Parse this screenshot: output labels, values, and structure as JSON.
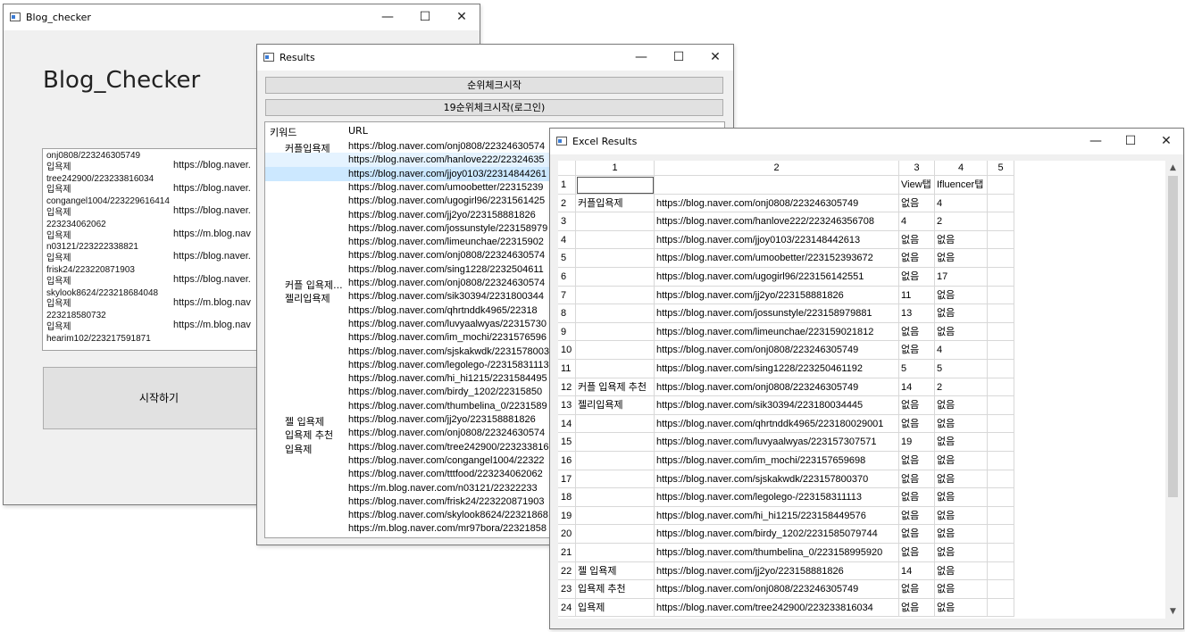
{
  "window_main": {
    "title": "Blog_checker",
    "heading": "Blog_Checker",
    "start_label": "시작하기",
    "log_lines": [
      "onj0808/223246305749",
      "입욕제",
      "tree242900/223233816034",
      "입욕제",
      "congangel1004/223229616414",
      "입욕제",
      "223234062062",
      "입욕제",
      "n03121/223222338821",
      "입욕제",
      "frisk24/223220871903",
      "입욕제",
      "skylook8624/223218684048",
      "입욕제",
      "223218580732",
      "입욕제",
      "hearim102/223217591871"
    ],
    "log_urls": [
      "https://blog.naver.",
      "https://blog.naver.",
      "https://blog.naver.",
      "https://m.blog.nav",
      "https://blog.naver.",
      "https://blog.naver.",
      "https://m.blog.nav",
      "https://m.blog.nav"
    ]
  },
  "window_results": {
    "title": "Results",
    "rank_check_label": "순위체크시작",
    "rank_check_19_label": "19순위체크시작(로그인)",
    "columns": [
      "키워드",
      "URL"
    ],
    "rows": [
      {
        "kw": "커플입욕제",
        "url": "https://blog.naver.com/onj0808/22324630574"
      },
      {
        "kw": "",
        "url": "https://blog.naver.com/hanlove222/22324635"
      },
      {
        "kw": "",
        "url": "https://blog.naver.com/jjoy0103/22314844261"
      },
      {
        "kw": "",
        "url": "https://blog.naver.com/umoobetter/22315239"
      },
      {
        "kw": "",
        "url": "https://blog.naver.com/ugogirl96/2231561425"
      },
      {
        "kw": "",
        "url": "https://blog.naver.com/jj2yo/223158881826"
      },
      {
        "kw": "",
        "url": "https://blog.naver.com/jossunstyle/223158979"
      },
      {
        "kw": "",
        "url": "https://blog.naver.com/limeunchae/22315902"
      },
      {
        "kw": "",
        "url": "https://blog.naver.com/onj0808/22324630574"
      },
      {
        "kw": "",
        "url": "https://blog.naver.com/sing1228/2232504611"
      },
      {
        "kw": "커플 입욕제...",
        "url": "https://blog.naver.com/onj0808/22324630574"
      },
      {
        "kw": "젤리입욕제",
        "url": "https://blog.naver.com/sik30394/2231800344"
      },
      {
        "kw": "",
        "url": "https://blog.naver.com/qhrtnddk4965/22318"
      },
      {
        "kw": "",
        "url": "https://blog.naver.com/luvyaalwyas/22315730"
      },
      {
        "kw": "",
        "url": "https://blog.naver.com/im_mochi/2231576596"
      },
      {
        "kw": "",
        "url": "https://blog.naver.com/sjskakwdk/22315780037"
      },
      {
        "kw": "",
        "url": "https://blog.naver.com/legolego-/22315831113"
      },
      {
        "kw": "",
        "url": "https://blog.naver.com/hi_hi1215/2231584495"
      },
      {
        "kw": "",
        "url": "https://blog.naver.com/birdy_1202/22315850"
      },
      {
        "kw": "",
        "url": "https://blog.naver.com/thumbelina_0/2231589"
      },
      {
        "kw": "젤 입욕제",
        "url": "https://blog.naver.com/jj2yo/223158881826"
      },
      {
        "kw": "입욕제 추천",
        "url": "https://blog.naver.com/onj0808/22324630574"
      },
      {
        "kw": "입욕제",
        "url": "https://blog.naver.com/tree242900/2232338160"
      },
      {
        "kw": "",
        "url": "https://blog.naver.com/congangel1004/22322"
      },
      {
        "kw": "",
        "url": "https://blog.naver.com/tttfood/223234062062"
      },
      {
        "kw": "",
        "url": "https://m.blog.naver.com/n03121/22322233"
      },
      {
        "kw": "",
        "url": "https://blog.naver.com/frisk24/223220871903"
      },
      {
        "kw": "",
        "url": "https://blog.naver.com/skylook8624/22321868"
      },
      {
        "kw": "",
        "url": "https://m.blog.naver.com/mr97bora/22321858"
      }
    ]
  },
  "window_excel": {
    "title": "Excel Results",
    "col_headers": [
      "1",
      "2",
      "3",
      "4",
      "5"
    ],
    "rows": [
      {
        "n": "1",
        "c1": "",
        "c2": "",
        "c3": "View탭",
        "c4": "Ifluencer탭"
      },
      {
        "n": "2",
        "c1": "커플입욕제",
        "c2": "https://blog.naver.com/onj0808/223246305749",
        "c3": "없음",
        "c4": "4"
      },
      {
        "n": "3",
        "c1": "",
        "c2": "https://blog.naver.com/hanlove222/223246356708",
        "c3": "4",
        "c4": "2"
      },
      {
        "n": "4",
        "c1": "",
        "c2": "https://blog.naver.com/jjoy0103/223148442613",
        "c3": "없음",
        "c4": "없음"
      },
      {
        "n": "5",
        "c1": "",
        "c2": "https://blog.naver.com/umoobetter/223152393672",
        "c3": "없음",
        "c4": "없음"
      },
      {
        "n": "6",
        "c1": "",
        "c2": "https://blog.naver.com/ugogirl96/223156142551",
        "c3": "없음",
        "c4": "17"
      },
      {
        "n": "7",
        "c1": "",
        "c2": "https://blog.naver.com/jj2yo/223158881826",
        "c3": "11",
        "c4": "없음"
      },
      {
        "n": "8",
        "c1": "",
        "c2": "https://blog.naver.com/jossunstyle/223158979881",
        "c3": "13",
        "c4": "없음"
      },
      {
        "n": "9",
        "c1": "",
        "c2": "https://blog.naver.com/limeunchae/223159021812",
        "c3": "없음",
        "c4": "없음"
      },
      {
        "n": "10",
        "c1": "",
        "c2": "https://blog.naver.com/onj0808/223246305749",
        "c3": "없음",
        "c4": "4"
      },
      {
        "n": "11",
        "c1": "",
        "c2": "https://blog.naver.com/sing1228/223250461192",
        "c3": "5",
        "c4": "5"
      },
      {
        "n": "12",
        "c1": "커플 입욕제 추천",
        "c2": "https://blog.naver.com/onj0808/223246305749",
        "c3": "14",
        "c4": "2"
      },
      {
        "n": "13",
        "c1": "젤리입욕제",
        "c2": "https://blog.naver.com/sik30394/223180034445",
        "c3": "없음",
        "c4": "없음"
      },
      {
        "n": "14",
        "c1": "",
        "c2": "https://blog.naver.com/qhrtnddk4965/223180029001",
        "c3": "없음",
        "c4": "없음"
      },
      {
        "n": "15",
        "c1": "",
        "c2": "https://blog.naver.com/luvyaalwyas/223157307571",
        "c3": "19",
        "c4": "없음"
      },
      {
        "n": "16",
        "c1": "",
        "c2": "https://blog.naver.com/im_mochi/223157659698",
        "c3": "없음",
        "c4": "없음"
      },
      {
        "n": "17",
        "c1": "",
        "c2": "https://blog.naver.com/sjskakwdk/223157800370",
        "c3": "없음",
        "c4": "없음"
      },
      {
        "n": "18",
        "c1": "",
        "c2": "https://blog.naver.com/legolego-/223158311113",
        "c3": "없음",
        "c4": "없음"
      },
      {
        "n": "19",
        "c1": "",
        "c2": "https://blog.naver.com/hi_hi1215/223158449576",
        "c3": "없음",
        "c4": "없음"
      },
      {
        "n": "20",
        "c1": "",
        "c2": "https://blog.naver.com/birdy_1202/2231585079744",
        "c3": "없음",
        "c4": "없음"
      },
      {
        "n": "21",
        "c1": "",
        "c2": "https://blog.naver.com/thumbelina_0/223158995920",
        "c3": "없음",
        "c4": "없음"
      },
      {
        "n": "22",
        "c1": "젤 입욕제",
        "c2": "https://blog.naver.com/jj2yo/223158881826",
        "c3": "14",
        "c4": "없음"
      },
      {
        "n": "23",
        "c1": "입욕제 추천",
        "c2": "https://blog.naver.com/onj0808/223246305749",
        "c3": "없음",
        "c4": "없음"
      },
      {
        "n": "24",
        "c1": "입욕제",
        "c2": "https://blog.naver.com/tree242900/223233816034",
        "c3": "없음",
        "c4": "없음"
      }
    ]
  },
  "controls": {
    "minimize": "—",
    "maximize": "☐",
    "close": "✕",
    "scroll_up": "▲",
    "scroll_down": "▼"
  }
}
